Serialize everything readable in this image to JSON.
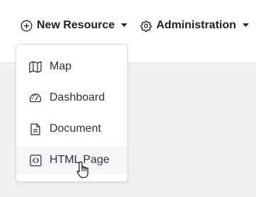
{
  "navbar": {
    "new_resource": {
      "label": "New Resource",
      "icon": "plus-circle-icon"
    },
    "administration": {
      "label": "Administration",
      "icon": "gear-icon"
    }
  },
  "dropdown": {
    "items": [
      {
        "label": "Map",
        "icon": "map-icon"
      },
      {
        "label": "Dashboard",
        "icon": "dashboard-gauge-icon"
      },
      {
        "label": "Document",
        "icon": "document-icon"
      },
      {
        "label": "HTML Page",
        "icon": "code-icon",
        "hovered": true
      }
    ]
  },
  "colors": {
    "text": "#1e2124",
    "menu_text": "#2f3338",
    "background": "#eef0f2",
    "hover": "#f5f6f7"
  }
}
